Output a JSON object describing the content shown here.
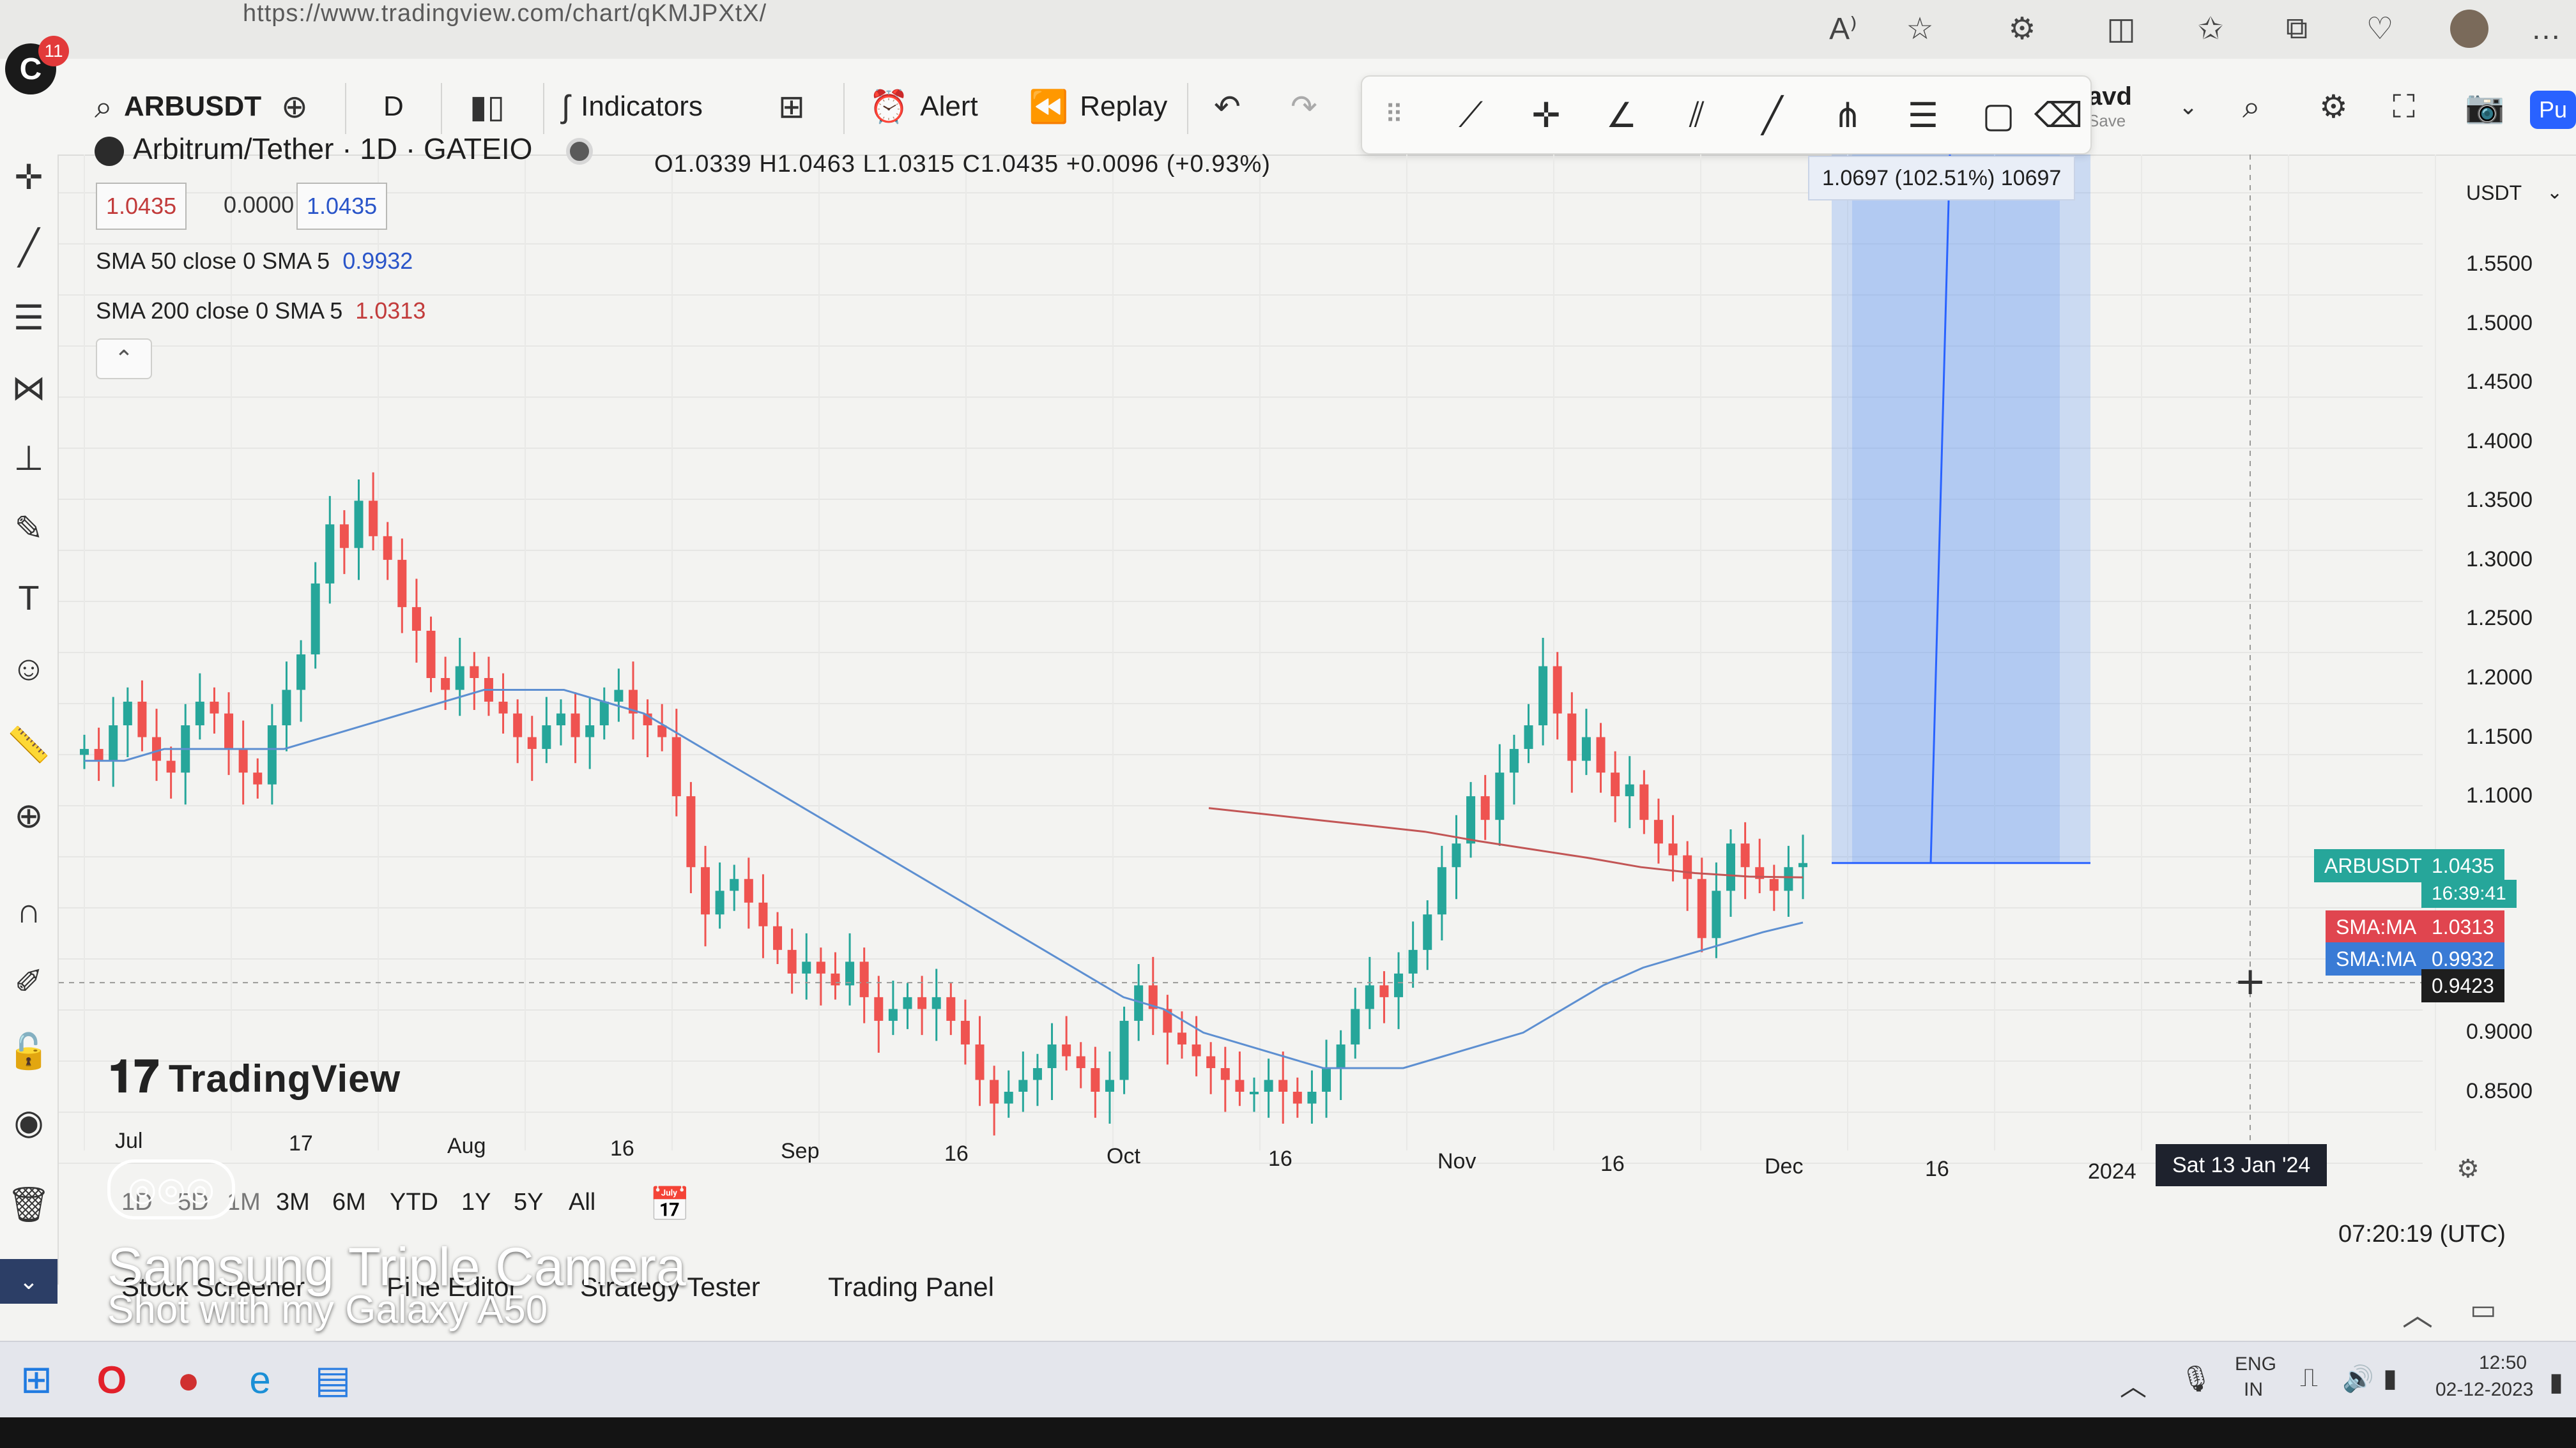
{
  "browser": {
    "url": "https://www.tradingview.com/chart/qKMJPXtX/",
    "read_aloud": "A⁾"
  },
  "toolbar": {
    "symbol": "ARBUSDT",
    "interval": "D",
    "indicators": "Indicators",
    "alert": "Alert",
    "replay": "Replay",
    "save_name": "avd",
    "save_sub": "Save",
    "publish": "Pu"
  },
  "alerts_badge": "11",
  "legend": {
    "title": "Arbitrum/Tether · 1D · GATEIO",
    "ohlc": "O1.0339  H1.0463  L1.0315  C1.0435  +0.0096 (+0.93%)",
    "price_boxes": [
      "1.0435",
      "0.0000",
      "1.0435"
    ],
    "indicators": [
      {
        "label": "SMA 50 close 0 SMA 5",
        "value": "0.9932"
      },
      {
        "label": "SMA 200 close 0 SMA 5",
        "value": "1.0313"
      }
    ]
  },
  "measure_label": "1.0697 (102.51%) 10697",
  "price_axis": {
    "currency": "USDT",
    "ticks": [
      "1.5500",
      "1.5000",
      "1.4500",
      "1.4000",
      "1.3500",
      "1.3000",
      "1.2500",
      "1.2000",
      "1.1500",
      "1.1000",
      "0.9000",
      "0.8500"
    ],
    "tags": [
      {
        "name": "ARBUSDT",
        "value": "1.0435",
        "color": "#26a69a"
      },
      {
        "name": "",
        "value": "16:39:41",
        "color": "#26a69a"
      },
      {
        "name": "SMA:MA",
        "value": "1.0313",
        "color": "#e0454f"
      },
      {
        "name": "SMA:MA",
        "value": "0.9932",
        "color": "#3a7bd5"
      },
      {
        "name": "",
        "value": "0.9423",
        "color": "#1e1e1e"
      }
    ]
  },
  "time_axis": {
    "ticks": [
      "Jul",
      "17",
      "Aug",
      "16",
      "Sep",
      "16",
      "Oct",
      "16",
      "Nov",
      "16",
      "Dec",
      "16",
      "2024"
    ],
    "crosshair": "Sat 13 Jan '24"
  },
  "branding": {
    "watermark": "TradingView"
  },
  "ranges": [
    "1D",
    "5D",
    "1M",
    "3M",
    "6M",
    "YTD",
    "1Y",
    "5Y",
    "All"
  ],
  "clock": "07:20:19 (UTC)",
  "bottom_tabs": [
    "Stock Screener",
    "Pine Editor",
    "Strategy Tester",
    "Trading Panel"
  ],
  "camera": {
    "line1": "Samsung Triple Camera",
    "line2": "Shot with my Galaxy A50"
  },
  "tray": {
    "lang": "ENG",
    "region": "IN",
    "time": "12:50",
    "date": "02-12-2023"
  },
  "chart_data": {
    "type": "candlestick",
    "title": "Arbitrum/Tether · 1D · GATEIO",
    "ylim": [
      0.82,
      1.58
    ],
    "x_start": "2023-07-01",
    "x_end": "2024-01-20",
    "close": [
      1.14,
      1.13,
      1.16,
      1.18,
      1.15,
      1.13,
      1.12,
      1.16,
      1.18,
      1.17,
      1.14,
      1.12,
      1.11,
      1.16,
      1.19,
      1.22,
      1.28,
      1.33,
      1.31,
      1.35,
      1.32,
      1.3,
      1.26,
      1.24,
      1.2,
      1.19,
      1.21,
      1.2,
      1.18,
      1.17,
      1.15,
      1.14,
      1.16,
      1.17,
      1.15,
      1.16,
      1.18,
      1.19,
      1.17,
      1.16,
      1.15,
      1.1,
      1.04,
      1.0,
      1.02,
      1.03,
      1.01,
      0.99,
      0.97,
      0.95,
      0.96,
      0.95,
      0.94,
      0.96,
      0.93,
      0.91,
      0.92,
      0.93,
      0.92,
      0.93,
      0.91,
      0.89,
      0.86,
      0.84,
      0.85,
      0.86,
      0.87,
      0.89,
      0.88,
      0.87,
      0.85,
      0.86,
      0.91,
      0.94,
      0.92,
      0.9,
      0.89,
      0.88,
      0.87,
      0.86,
      0.85,
      0.85,
      0.86,
      0.85,
      0.84,
      0.85,
      0.87,
      0.89,
      0.92,
      0.94,
      0.93,
      0.95,
      0.97,
      1.0,
      1.04,
      1.06,
      1.1,
      1.08,
      1.12,
      1.14,
      1.16,
      1.21,
      1.17,
      1.13,
      1.15,
      1.12,
      1.1,
      1.11,
      1.08,
      1.06,
      1.05,
      1.03,
      0.98,
      1.02,
      1.06,
      1.04,
      1.03,
      1.02,
      1.04,
      1.0435
    ],
    "sma50": [
      1.13,
      1.13,
      1.14,
      1.14,
      1.14,
      1.14,
      1.15,
      1.16,
      1.17,
      1.18,
      1.19,
      1.19,
      1.19,
      1.18,
      1.17,
      1.15,
      1.13,
      1.11,
      1.09,
      1.07,
      1.05,
      1.03,
      1.01,
      0.99,
      0.97,
      0.95,
      0.93,
      0.92,
      0.9,
      0.89,
      0.88,
      0.87,
      0.87,
      0.87,
      0.88,
      0.89,
      0.9,
      0.92,
      0.94,
      0.955,
      0.965,
      0.975,
      0.985,
      0.9932
    ],
    "sma200": [
      1.09,
      1.085,
      1.08,
      1.075,
      1.07,
      1.062,
      1.055,
      1.048,
      1.04,
      1.035,
      1.032,
      1.0313
    ]
  }
}
